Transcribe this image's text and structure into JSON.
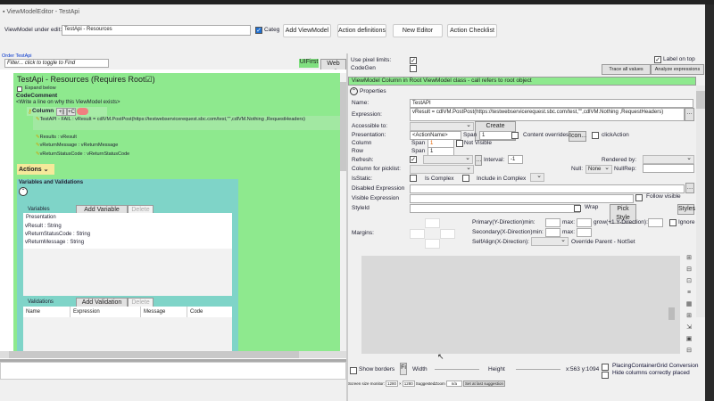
{
  "window": {
    "title": "ViewModelEditor - TestApi"
  },
  "toolbar": {
    "vm_label": "ViewModel under edit:",
    "vm_value": "TestApi - Resources",
    "categ_label": "Categ",
    "add_viewmodel": "Add ViewModel",
    "action_definitions": "Action definitions",
    "new_editor": "New Editor",
    "action_checklist": "Action Checklist"
  },
  "left": {
    "order_link": "Order TestApi",
    "filter_placeholder": "Filter... click to toggle to Find",
    "ui_first": "UIFirst",
    "web_edit": "Web Edit",
    "header": "TestApi - Resources  (Requires Root☑)",
    "expand_label": "Expand below",
    "code_comment": "CodeComment",
    "comment_hint": "<Write a line on why this ViewModel exists>",
    "column_label": "Column",
    "col_btn1": "+||",
    "col_btn2": "+C",
    "rows": [
      "TestAPI - FAIL : vResult = cdlVM.PostPost(https://testwebservicerequest.sbc.com/test,\"\",cdlVM.Nothing ,RequestHeaders)",
      "Results : vResult",
      "vReturnMessage : vReturnMessage",
      "vReturnStatusCode : vReturnStatusCode"
    ],
    "actions_label": "Actions",
    "vv_title": "Variables and Validations",
    "variables_label": "Variables",
    "add_variable": "Add Variable",
    "delete": "Delete",
    "variables_header": "Presentation",
    "variables": [
      "vResult : String",
      "vReturnStatusCode : String",
      "vReturnMessage : String"
    ],
    "validations_label": "Validations",
    "add_validation": "Add Validation",
    "validations_columns": [
      "Name",
      "Expression",
      "Message",
      "Code"
    ]
  },
  "right": {
    "use_pixel_limits": "Use pixel limits:",
    "codegen": "CodeGen",
    "label_on_top": "Label on top",
    "trace_values": "Trace all values",
    "analyze_expressions": "Analyze expressions",
    "banner": "ViewModel Column in Root ViewModel class - call refers to root object",
    "properties": "Properties",
    "name_label": "Name:",
    "name_value": "TestAPI",
    "expression_label": "Expression:",
    "expression_value": "vResult = cdlVM.PostPost(https://testwebservicerequest.sbc.com/test,\"\",cdlVM.Nothing ,RequestHeaders)",
    "accessible_label": "Accessible to:",
    "create_nesting": "Create Nesting",
    "presentation_label": "Presentation:",
    "presentation_value": "<ActionName>",
    "span": "Span",
    "span1": "1",
    "content_overrides": "Content overrides",
    "icon_btn": "Icon...",
    "click_action": "clickAction",
    "column_label": "Column",
    "column_span": "1",
    "not_visible": "Not Visible",
    "row_label": "Row",
    "row_span": "1",
    "refresh_label": "Refresh:",
    "interval_label": "Interval:",
    "interval_value": "-1",
    "rendered_by": "Rendered by:",
    "picklist_label": "Column for picklist:",
    "null_label": "Null:",
    "null_value": "None",
    "nullrep_label": "NullRep:",
    "isstatic_label": "IsStatic:",
    "is_complex": "Is Complex",
    "include_complex": "Include in Complex",
    "disabled_expr": "Disabled Expression",
    "visible_expr": "Visible Expression",
    "follow_visible": "Follow visible",
    "styleid": "StyleId",
    "wrap": "Wrap",
    "pick_style": "Pick Style",
    "styles": "Styles",
    "margins": "Margins:",
    "primary_min": "Primary(Y-Direction)min:",
    "max": "max:",
    "grow": "grow(+1 Y-Direction):",
    "ignore": "Ignore",
    "secondary_min": "Secondary(X-Direction)min:",
    "selfalign": "SelfAlign(X-Direction):",
    "override_parent": "Override Parent - NotSet",
    "show_borders": "Show borders",
    "width": "Width",
    "height": "Height",
    "coords": "x:563 y:1094",
    "placing": "PlacingContainerGrid Conversion",
    "hide_columns": "Hide columns correctly placed",
    "screen_size_label": "Screen size monitor:",
    "w": "1280",
    "h": "1280",
    "suggested_zoom": "SuggestedZoom",
    "zoom_value": "n/a",
    "set_suggested": "Set at last suggestion"
  }
}
